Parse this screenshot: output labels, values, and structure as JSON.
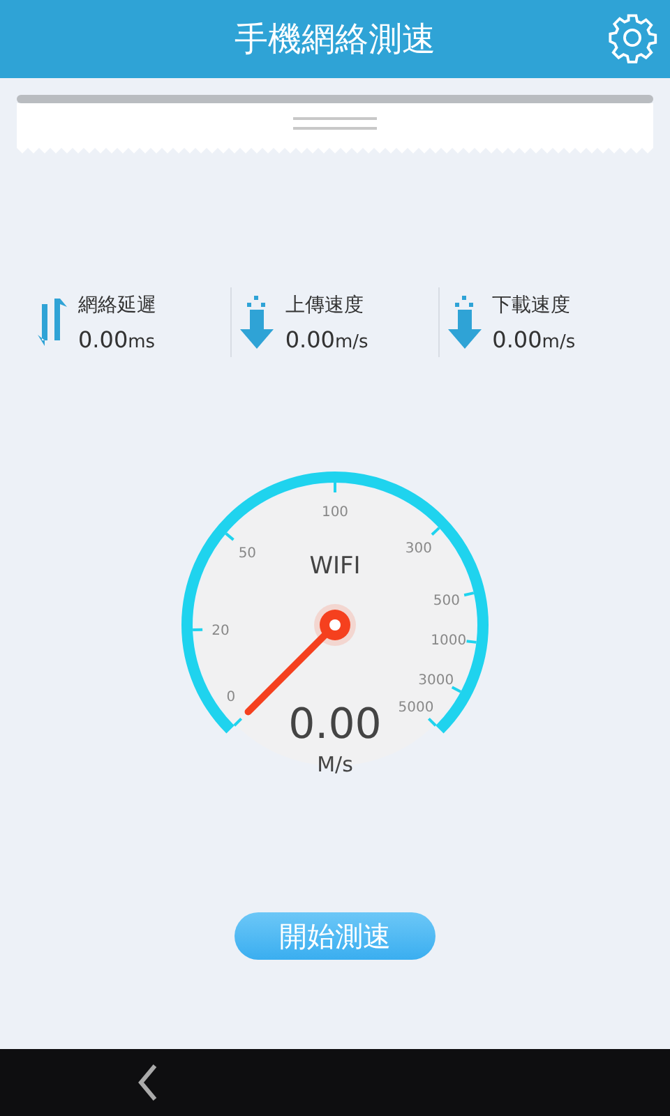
{
  "header": {
    "title": "手機網絡測速"
  },
  "stats": [
    {
      "kind": "latency",
      "label": "網絡延遲",
      "value": "0.00",
      "unit": "ms"
    },
    {
      "kind": "upload",
      "label": "上傳速度",
      "value": "0.00",
      "unit": "m/s"
    },
    {
      "kind": "download",
      "label": "下載速度",
      "value": "0.00",
      "unit": "m/s"
    }
  ],
  "gauge": {
    "network": "WIFI",
    "reading": "0.00",
    "unit": "M/s",
    "scale": [
      "0",
      "20",
      "50",
      "100",
      "300",
      "500",
      "1000",
      "3000",
      "5000"
    ]
  },
  "start_button": {
    "label": "開始測速"
  }
}
